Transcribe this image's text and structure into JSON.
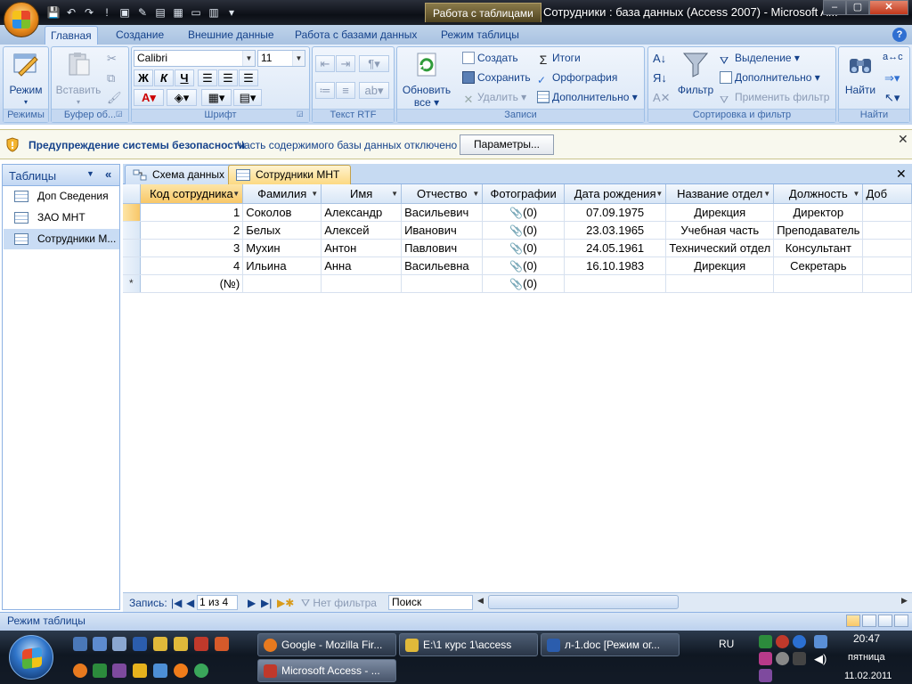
{
  "title_bar": {
    "context_tab": "Работа с таблицами",
    "window_title": "Сотрудники : база данных (Access 2007) - Microsoft A...",
    "minimize": "–",
    "maximize": "▢",
    "close": "✕"
  },
  "ribbon_tabs": [
    "Главная",
    "Создание",
    "Внешние данные",
    "Работа с базами данных",
    "Режим таблицы"
  ],
  "help": "?",
  "ribbon": {
    "modes": {
      "button": "Режим",
      "label": "Режимы"
    },
    "clipboard": {
      "paste": "Вставить",
      "label": "Буфер об..."
    },
    "font": {
      "font_name": "Calibri",
      "font_size": "11",
      "bold": "Ж",
      "italic": "К",
      "underline": "Ч",
      "label": "Шрифт"
    },
    "rtf": {
      "label": "Текст RTF"
    },
    "records": {
      "refresh": "Обновить",
      "refresh_sub": "все",
      "create": "Создать",
      "save": "Сохранить",
      "delete": "Удалить",
      "totals": "Итоги",
      "spelling": "Орфография",
      "more": "Дополнительно",
      "label": "Записи"
    },
    "sort_filter": {
      "filter": "Фильтр",
      "selection": "Выделение",
      "advanced": "Дополнительно",
      "apply": "Применить фильтр",
      "label": "Сортировка и фильтр"
    },
    "find": {
      "find": "Найти",
      "label": "Найти"
    }
  },
  "security": {
    "title": "Предупреждение системы безопасности",
    "text": "Часть содержимого базы данных отключено",
    "button": "Параметры..."
  },
  "nav": {
    "title": "Таблицы",
    "items": [
      "Доп Сведения",
      "ЗАО МНТ",
      "Сотрудники М..."
    ]
  },
  "doc_tabs": [
    "Схема данных",
    "Сотрудники МНТ"
  ],
  "table": {
    "columns": [
      "Код сотрудника",
      "Фамилия",
      "Имя",
      "Отчество",
      "Фотографии",
      "Дата рождения",
      "Название отдел",
      "Должность",
      "Доб"
    ],
    "rows": [
      [
        "1",
        "Соколов",
        "Александр",
        "Васильевич",
        "(0)",
        "07.09.1975",
        "Дирекция",
        "Директор",
        ""
      ],
      [
        "2",
        "Белых",
        "Алексей",
        "Иванович",
        "(0)",
        "23.03.1965",
        "Учебная часть",
        "Преподаватель",
        ""
      ],
      [
        "3",
        "Мухин",
        "Антон",
        "Павлович",
        "(0)",
        "24.05.1961",
        "Технический отдел",
        "Консультант",
        ""
      ],
      [
        "4",
        "Ильина",
        "Анна",
        "Васильевна",
        "(0)",
        "16.10.1983",
        "Дирекция",
        "Секретарь",
        ""
      ]
    ],
    "new_row": {
      "marker": "*",
      "key": "(№)",
      "photo": "(0)"
    }
  },
  "record_bar": {
    "label": "Запись:",
    "position": "1 из 4",
    "no_filter": "Нет фильтра",
    "search": "Поиск"
  },
  "status": {
    "text": "Режим таблицы"
  },
  "taskbar": {
    "buttons": [
      "Google - Mozilla Fir...",
      "E:\\1 курс 1\\access",
      "л-1.doc [Режим ог...",
      "Microsoft Access - ..."
    ],
    "lang": "RU",
    "time": "20:47",
    "day": "пятница",
    "date": "11.02.2011"
  }
}
